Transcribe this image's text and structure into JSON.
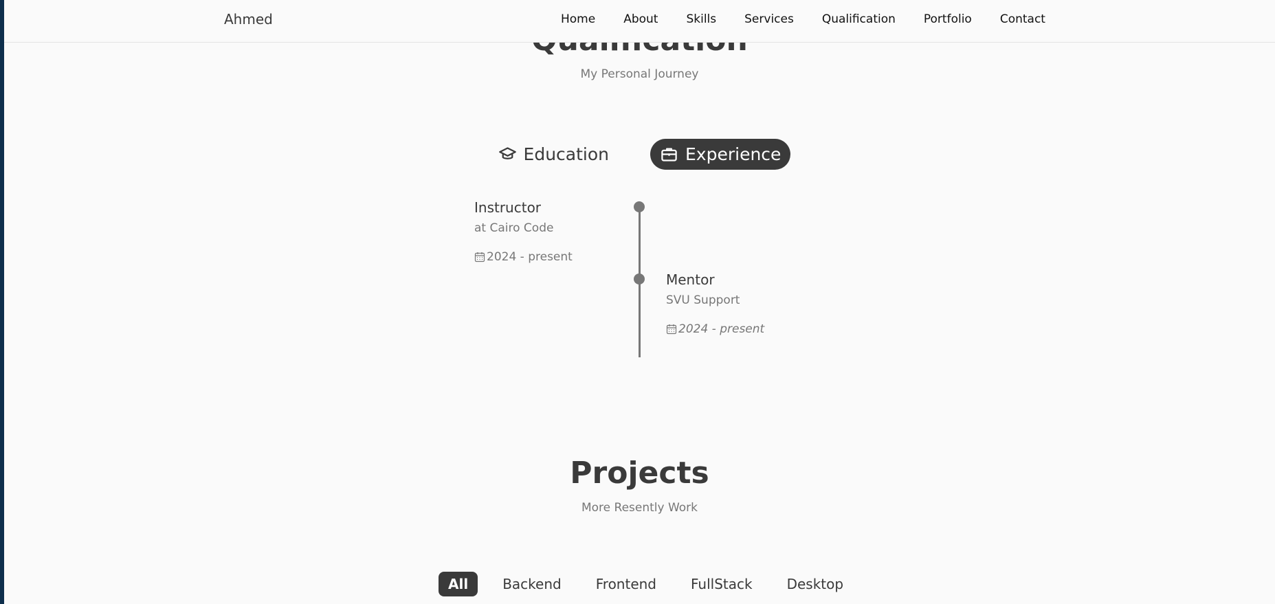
{
  "navbar": {
    "logo": "Ahmed",
    "links": [
      "Home",
      "About",
      "Skills",
      "Services",
      "Qualification",
      "Portfolio",
      "Contact"
    ]
  },
  "qualification": {
    "title": "Qualification",
    "subtitle": "My Personal Journey",
    "tabs": [
      {
        "label": "Education",
        "icon": "graduation-cap-icon",
        "active": false
      },
      {
        "label": "Experience",
        "icon": "briefcase-icon",
        "active": true
      }
    ],
    "entries": [
      {
        "role": "Instructor",
        "org": "at Cairo Code",
        "date": "2024 - present",
        "side": "left"
      },
      {
        "role": "Mentor",
        "org": "SVU Support",
        "date": "2024 - present",
        "side": "right"
      }
    ]
  },
  "projects": {
    "title": "Projects",
    "subtitle": "More Resently Work",
    "filters": [
      {
        "label": "All",
        "active": true
      },
      {
        "label": "Backend",
        "active": false
      },
      {
        "label": "Frontend",
        "active": false
      },
      {
        "label": "FullStack",
        "active": false
      },
      {
        "label": "Desktop",
        "active": false
      }
    ]
  },
  "colors": {
    "accent": "#3a3a3a",
    "muted": "#777777",
    "page_bg": "#fafafa",
    "frame_bg": "#0e2f4c"
  }
}
